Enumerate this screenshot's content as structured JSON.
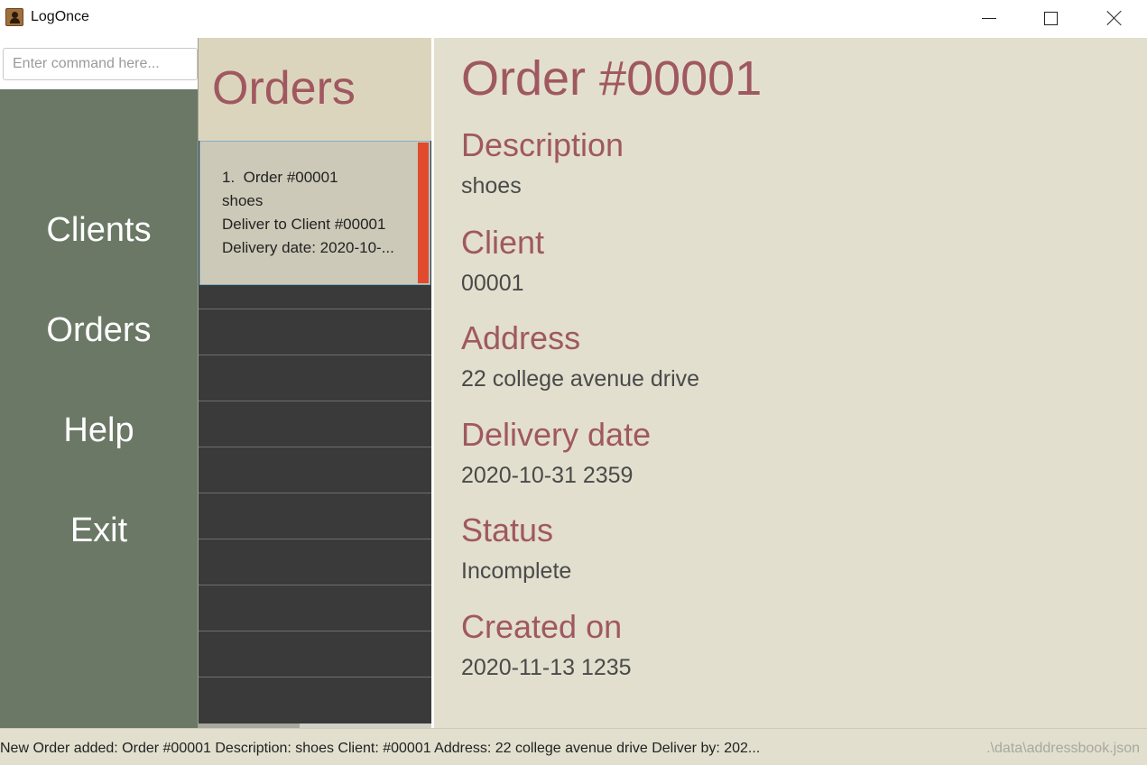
{
  "window": {
    "title": "LogOnce",
    "minimize_icon": "minimize-icon",
    "maximize_icon": "maximize-icon",
    "close_icon": "close-icon"
  },
  "command": {
    "placeholder": "Enter command here...",
    "value": ""
  },
  "sidebar": {
    "items": [
      {
        "label": "Clients"
      },
      {
        "label": "Orders"
      },
      {
        "label": "Help"
      },
      {
        "label": "Exit"
      }
    ]
  },
  "orders_list": {
    "title": "Orders",
    "items": [
      {
        "index": "1.",
        "title": "Order #00001",
        "description": "shoes",
        "client": "Deliver to Client #00001",
        "delivery": "Delivery date: 2020-10-...",
        "status_color": "#e14a2d"
      }
    ]
  },
  "detail": {
    "title": "Order #00001",
    "fields": [
      {
        "label": "Description",
        "value": "shoes"
      },
      {
        "label": "Client",
        "value": "00001"
      },
      {
        "label": "Address",
        "value": "22 college avenue drive"
      },
      {
        "label": "Delivery date",
        "value": "2020-10-31 2359"
      },
      {
        "label": "Status",
        "value": "Incomplete"
      },
      {
        "label": "Created on",
        "value": "2020-11-13 1235"
      }
    ]
  },
  "status_bar": {
    "message": "New Order added: Order #00001  Description: shoes Client: #00001 Address: 22 college avenue drive Deliver by: 202...",
    "path": ".\\data\\addressbook.json"
  },
  "colors": {
    "accent": "#a05860",
    "sidebar": "#6b7866",
    "panel": "#e2dfce",
    "list_bg": "#3a3a3a"
  }
}
